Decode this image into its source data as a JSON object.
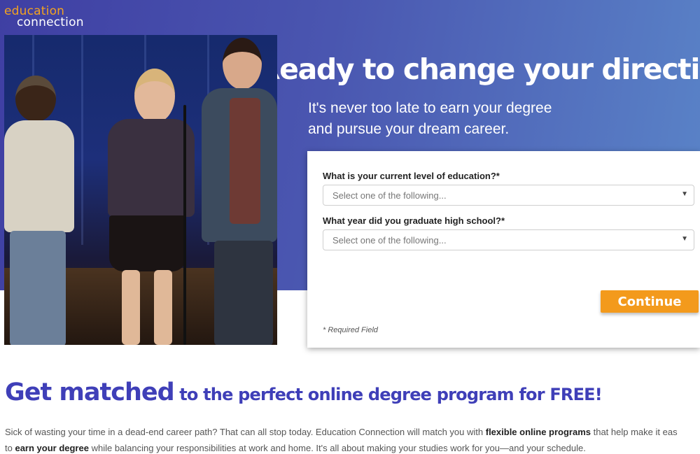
{
  "logo": {
    "top": "education",
    "bottom": "connection"
  },
  "hero": {
    "headline": "Ready to change your direction?",
    "subline_1": "It's never too late to earn your degree",
    "subline_2": "and pursue your dream career."
  },
  "form": {
    "q1_label": "What is your current level of education?*",
    "q1_placeholder": "Select one of the following...",
    "q2_label": "What year did you graduate high school?*",
    "q2_placeholder": "Select one of the following...",
    "continue_label": "Continue",
    "required_note": "* Required Field"
  },
  "promo": {
    "title_big": "Get matched",
    "title_rest": " to the perfect online degree program for FREE!",
    "p1_a": "Sick of wasting your time in a dead-end career path? That can all stop today. Education Connection will match you with ",
    "p1_bold": "flexible online programs",
    "p1_b": " that help make it eas",
    "p2_a": "to ",
    "p2_bold": "earn your degree",
    "p2_b": " while balancing your responsibilities at work and home. It's all about making your studies work for you—and your schedule."
  },
  "colors": {
    "accent": "#3f3fb8",
    "button": "#f39a1c",
    "logo_orange": "#f2a221"
  },
  "icons": {
    "select_arrow": "dropdown-arrow-icon"
  }
}
